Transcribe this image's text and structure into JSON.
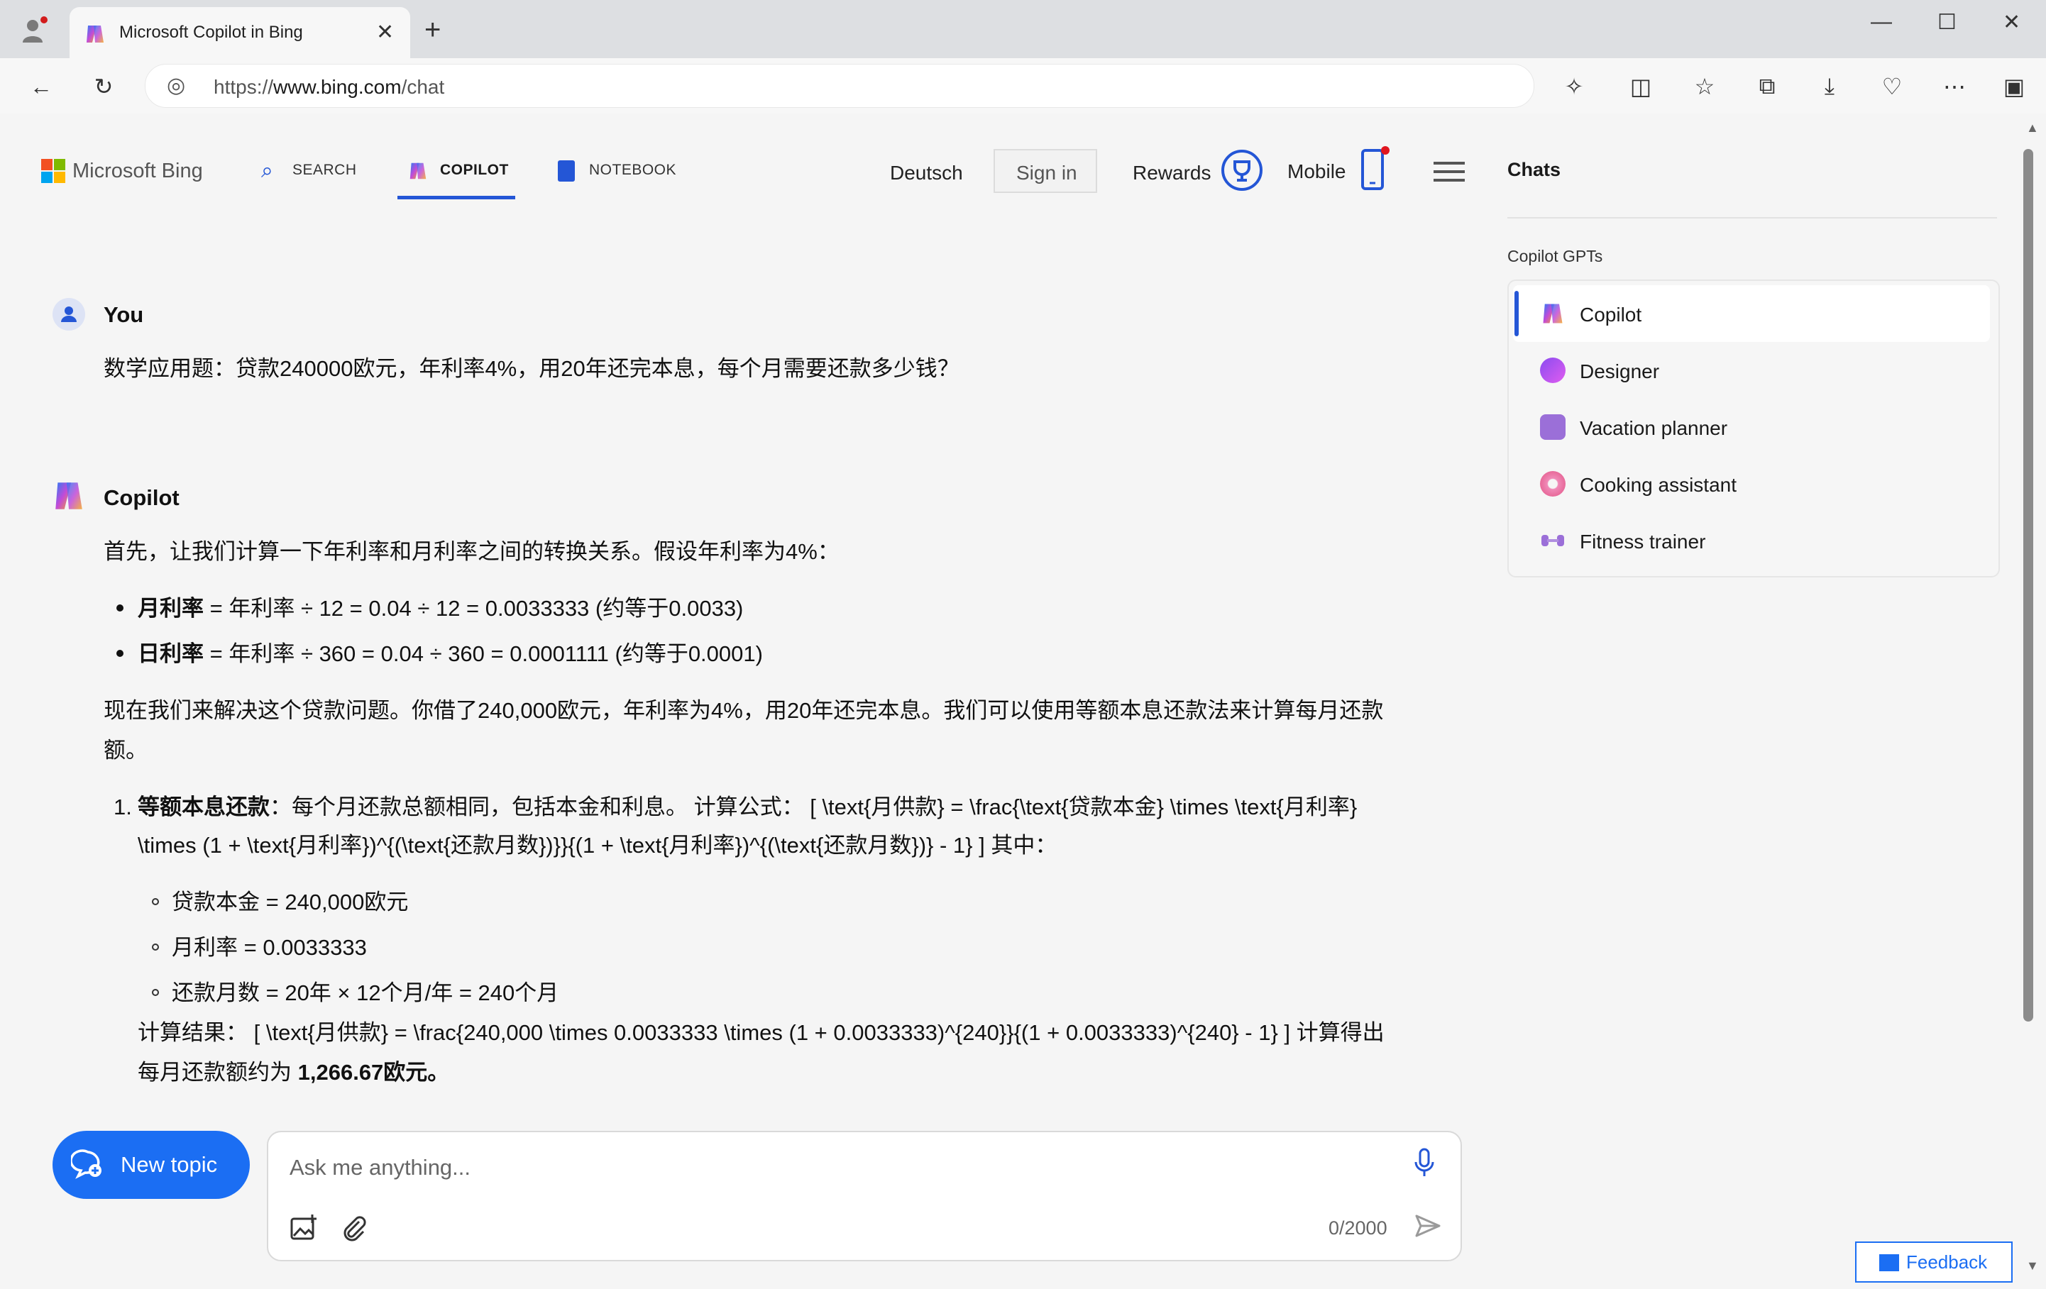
{
  "browser": {
    "tab_title": "Microsoft Copilot in Bing",
    "url_prefix": "https://",
    "url_main": "www.bing.com",
    "url_path": "/chat"
  },
  "header": {
    "brand": "Microsoft Bing",
    "nav": [
      {
        "label": "SEARCH",
        "icon": "search-icon"
      },
      {
        "label": "COPILOT",
        "icon": "copilot-icon",
        "active": true
      },
      {
        "label": "NOTEBOOK",
        "icon": "notebook-icon"
      }
    ],
    "language": "Deutsch",
    "sign_in": "Sign in",
    "rewards": "Rewards",
    "mobile": "Mobile"
  },
  "conversation": {
    "user_name": "You",
    "user_message": "数学应用题：贷款240000欧元，年利率4%，用20年还完本息，每个月需要还款多少钱？",
    "bot_name": "Copilot",
    "intro": "首先，让我们计算一下年利率和月利率之间的转换关系。假设年利率为4%：",
    "rates": [
      {
        "term": "月利率",
        "text": " = 年利率 ÷ 12 = 0.04 ÷ 12 = 0.0033333 (约等于0.0033)"
      },
      {
        "term": "日利率",
        "text": " = 年利率 ÷ 360 = 0.04 ÷ 360 = 0.0001111 (约等于0.0001)"
      }
    ],
    "para_line1": "现在我们来解决这个贷款问题。你借了240,000欧元，年利率为4%，用20年还完本息。我们可以使用等额本息还款法来计算每月还款",
    "para_line2": "额。",
    "method_number": "1.",
    "method_term": "等额本息还款",
    "method_line1": "：每个月还款总额相同，包括本金和利息。 计算公式： [ \\text{月供款} = \\frac{\\text{贷款本金} \\times \\text{月利率}",
    "method_line2": "\\times (1 + \\text{月利率})^{(\\text{还款月数})}}{(1 + \\text{月利率})^{(\\text{还款月数})} - 1} ] 其中：",
    "params": [
      "贷款本金 = 240,000欧元",
      "月利率 = 0.0033333",
      "还款月数 = 20年 × 12个月/年 = 240个月"
    ],
    "result_line1": "计算结果： [ \\text{月供款} = \\frac{240,000 \\times 0.0033333 \\times (1 + 0.0033333)^{240}}{(1 + 0.0033333)^{240} - 1} ] 计算得出",
    "result_line2_prefix": "每月还款额约为 ",
    "result_value": "1,266.67欧元。"
  },
  "sidebar": {
    "title": "Chats",
    "section": "Copilot GPTs",
    "gpts": [
      {
        "label": "Copilot",
        "icon": "copilot-icon",
        "selected": true
      },
      {
        "label": "Designer",
        "icon": "designer-icon"
      },
      {
        "label": "Vacation planner",
        "icon": "suitcase-icon"
      },
      {
        "label": "Cooking assistant",
        "icon": "donut-icon"
      },
      {
        "label": "Fitness trainer",
        "icon": "dumbbell-icon"
      }
    ]
  },
  "composer": {
    "new_topic": "New topic",
    "placeholder": "Ask me anything...",
    "counter": "0/2000"
  },
  "feedback": "Feedback",
  "colors": {
    "accent": "#1b6ef3",
    "nav_underline": "#2456d6"
  }
}
